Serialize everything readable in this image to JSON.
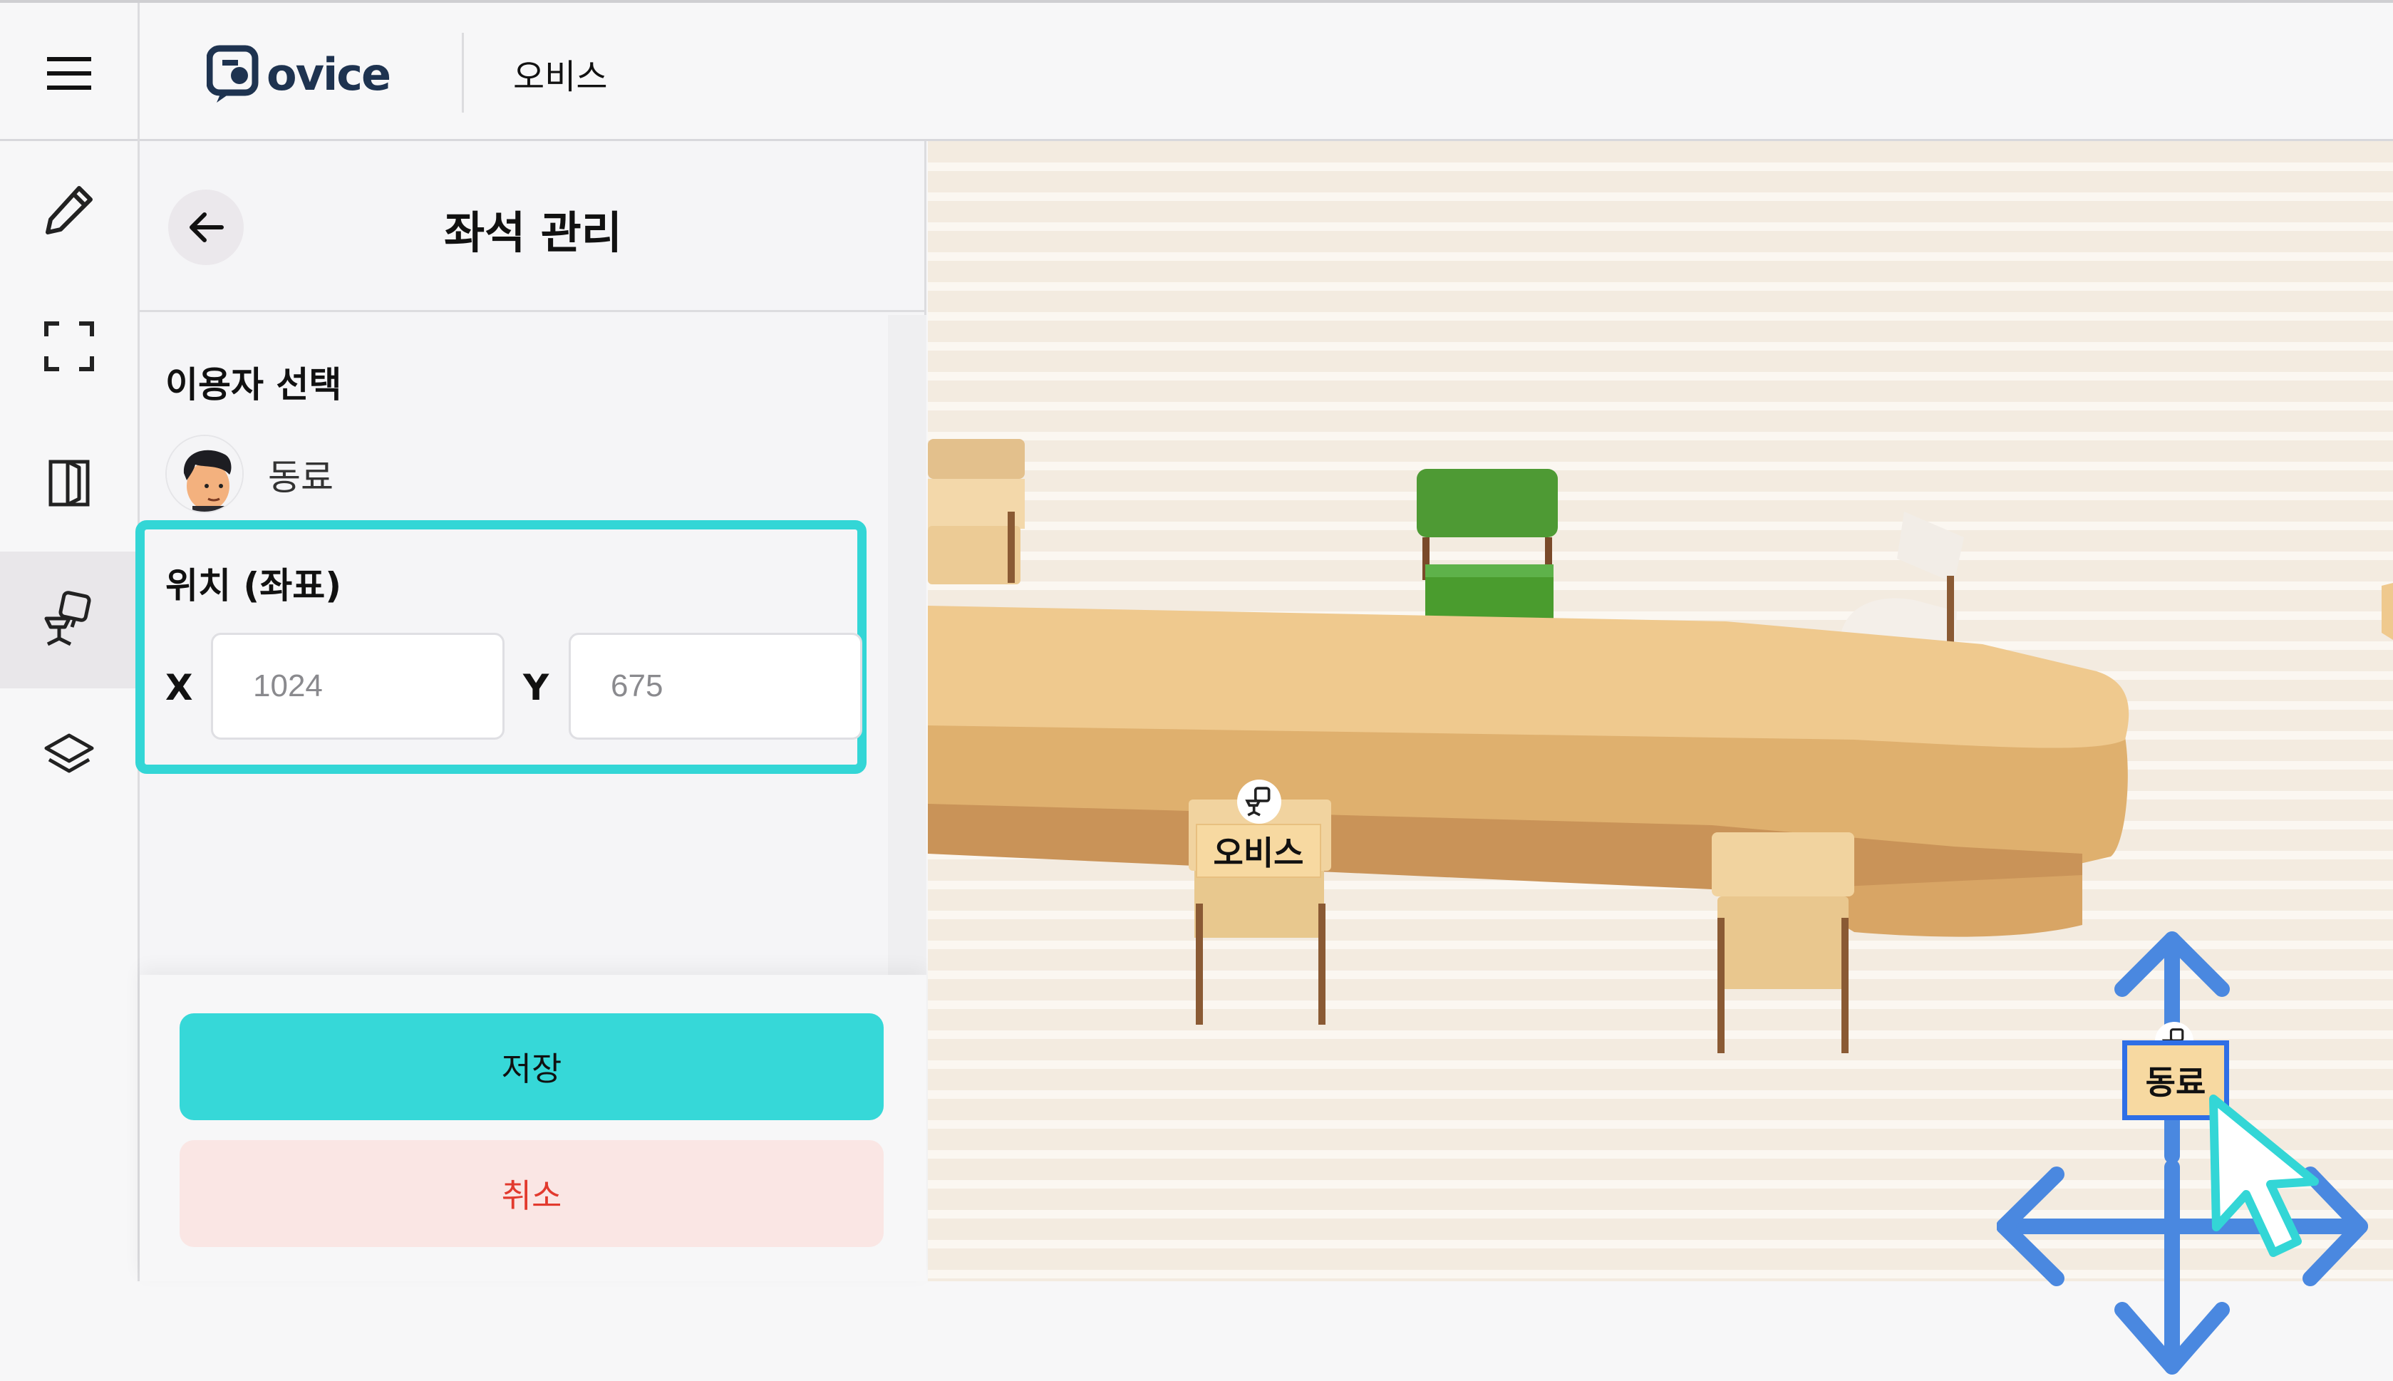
{
  "header": {
    "logo_text": "ovice",
    "workspace_name": "오비스"
  },
  "rail": {
    "items": [
      "menu-icon",
      "pencil-icon",
      "fullscreen-icon",
      "door-icon",
      "seat-icon",
      "layers-icon"
    ],
    "active": "seat-icon"
  },
  "panel": {
    "title": "좌석 관리",
    "user_section_label": "이용자 선택",
    "user_name": "동료",
    "coord_section_label": "위치 (좌표)",
    "x_label": "X",
    "y_label": "Y",
    "x_placeholder": "1024",
    "y_placeholder": "675",
    "save_label": "저장",
    "cancel_label": "취소"
  },
  "map": {
    "seats": [
      {
        "label": "오비스"
      },
      {
        "label": "동료",
        "selected": true
      }
    ]
  },
  "colors": {
    "accent": "#36d8d8",
    "cancel_bg": "#fae6e4",
    "cancel_text": "#e23a2e",
    "move_arrows": "#4a88e0",
    "logo": "#1e3350"
  }
}
